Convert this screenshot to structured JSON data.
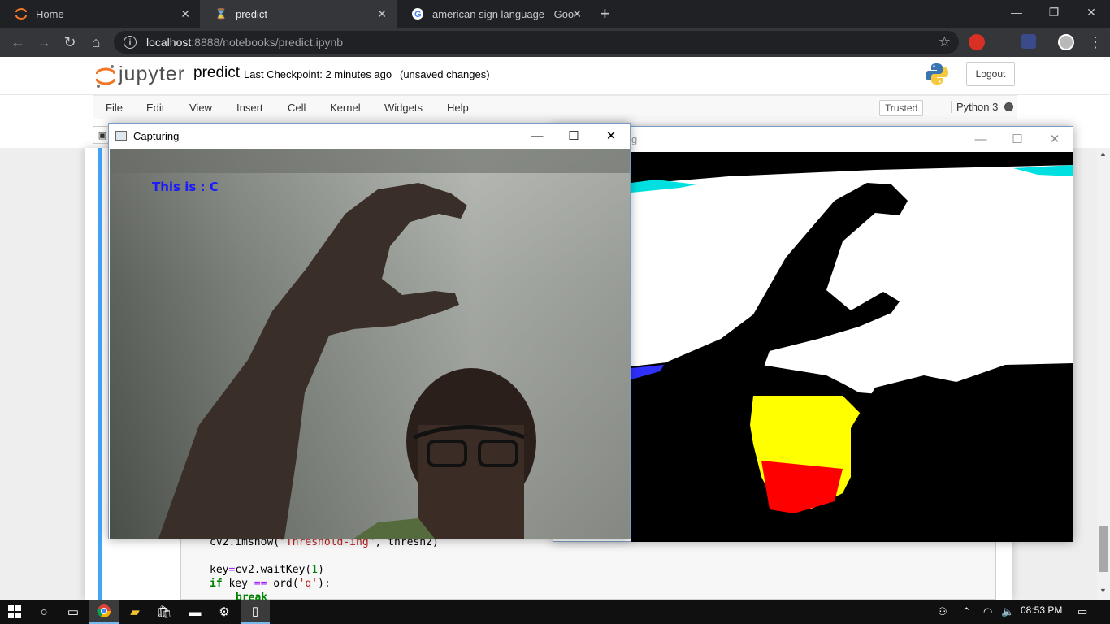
{
  "browser": {
    "tabs": [
      {
        "label": "Home",
        "icon": "jupyter-favicon"
      },
      {
        "label": "predict",
        "icon": "hourglass-favicon"
      },
      {
        "label": "american sign language - Google",
        "icon": "google-favicon"
      }
    ],
    "url_host": "localhost",
    "url_path": ":8888/notebooks/predict.ipynb"
  },
  "jupyter": {
    "logo_text": "jupyter",
    "notebook_name": "predict",
    "checkpoint": "Last Checkpoint: 2 minutes ago",
    "unsaved": "(unsaved changes)",
    "logout": "Logout",
    "menu": [
      "File",
      "Edit",
      "View",
      "Insert",
      "Cell",
      "Kernel",
      "Widgets",
      "Help"
    ],
    "trusted": "Trusted",
    "kernel": "Python 3"
  },
  "code": {
    "line1_fn": "cv2.imshow(",
    "line1_str": "\"Threshold-ing\"",
    "line1_rest": ", thresh2)",
    "line2_a": "key",
    "line2_op": "=",
    "line2_fn": "cv2.waitKey(",
    "line2_num": "1",
    "line2_end": ")",
    "line3_kw": "if",
    "line3_a": " key ",
    "line3_op": "==",
    "line3_fn": " ord(",
    "line3_str": "'q'",
    "line3_end": "):",
    "line4_kw": "break"
  },
  "windows": {
    "capturing_title": "Capturing",
    "capturing_overlay": "This is : C",
    "threshold_title_fragment": "g"
  },
  "taskbar": {
    "clock": "08:53 PM"
  },
  "colors": {
    "overlay_text": "#1a1aff",
    "jupyter_orange": "#f37626",
    "cell_selected": "#42a5f5"
  }
}
